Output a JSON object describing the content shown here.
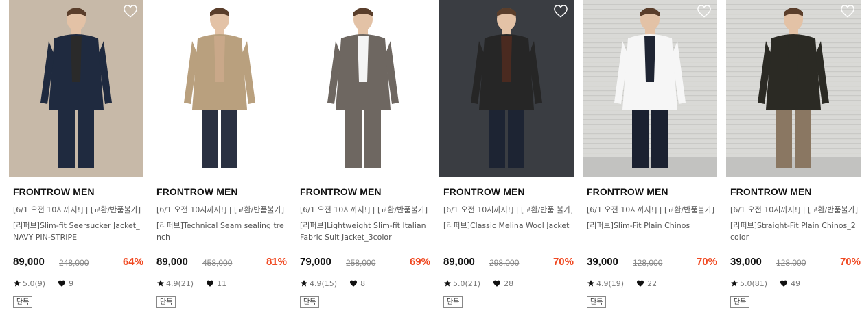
{
  "products": [
    {
      "brand": "FRONTROW MEN",
      "promo": "[6/1 오전 10시까지!] | [교환/반품불가]",
      "name": "[리퍼브]Slim-fit Seersucker Jacket_NAVY PIN-STRIPE",
      "price": "89,000",
      "original_price": "248,000",
      "discount": "64%",
      "rating": "5.0(9)",
      "likes": "9",
      "badge": "단독",
      "photo": {
        "bg": "#c7b9a8",
        "garment": "#1f2a3f",
        "inner": "#2a2a2a",
        "bottom": "#1f2a3f"
      }
    },
    {
      "brand": "FRONTROW MEN",
      "promo": "[6/1 오전 10시까지!] | [교환/반품불가]",
      "name": "[리퍼브]Technical Seam sealing trench",
      "price": "89,000",
      "original_price": "458,000",
      "discount": "81%",
      "rating": "4.9(21)",
      "likes": "11",
      "badge": "단독",
      "photo": {
        "bg": "#ffffff",
        "garment": "#b9a07e",
        "inner": "#c9a889",
        "bottom": "#2a3142"
      }
    },
    {
      "brand": "FRONTROW MEN",
      "promo": "[6/1 오전 10시까지!] | [교환/반품불가]",
      "name": "[리퍼브]Lightweight Slim-fit Italian Fabric Suit Jacket_3color",
      "price": "79,000",
      "original_price": "258,000",
      "discount": "69%",
      "rating": "4.9(15)",
      "likes": "8",
      "badge": "단독",
      "photo": {
        "bg": "#ffffff",
        "garment": "#6e6761",
        "inner": "#f4f4f4",
        "bottom": "#6e6761"
      }
    },
    {
      "brand": "FRONTROW MEN",
      "promo": "[6/1 오전 10시까지!] | [교환/반품 불가]",
      "name": "[리퍼브]Classic Melina Wool Jacket",
      "price": "89,000",
      "original_price": "298,000",
      "discount": "70%",
      "rating": "5.0(21)",
      "likes": "28",
      "badge": "단독",
      "photo": {
        "bg": "#3a3d42",
        "garment": "#262626",
        "inner": "#4a2a20",
        "bottom": "#1d2433"
      }
    },
    {
      "brand": "FRONTROW MEN",
      "promo": "[6/1 오전 10시까지!] | [교환/반품불가]",
      "name": "[리퍼브]Slim-Fit Plain Chinos",
      "price": "39,000",
      "original_price": "128,000",
      "discount": "70%",
      "rating": "4.9(19)",
      "likes": "22",
      "badge": "단독",
      "photo": {
        "bg": "#d9d9d6",
        "garment": "#f6f6f6",
        "inner": "#1f2533",
        "bottom": "#1b2130"
      }
    },
    {
      "brand": "FRONTROW MEN",
      "promo": "[6/1 오전 10시까지!] | [교환/반품불가]",
      "name": "[리퍼브]Straight-Fit Plain Chinos_2color",
      "price": "39,000",
      "original_price": "128,000",
      "discount": "70%",
      "rating": "5.0(81)",
      "likes": "49",
      "badge": "단독",
      "photo": {
        "bg": "#d9d9d6",
        "garment": "#2b2a24",
        "inner": "#2b2a24",
        "bottom": "#8a7762"
      }
    }
  ],
  "icons": {
    "wish": "heart-outline-icon",
    "rating": "star-icon",
    "likes": "heart-icon"
  },
  "colors": {
    "discount": "#f04a23",
    "text": "#222222",
    "muted": "#777777"
  }
}
